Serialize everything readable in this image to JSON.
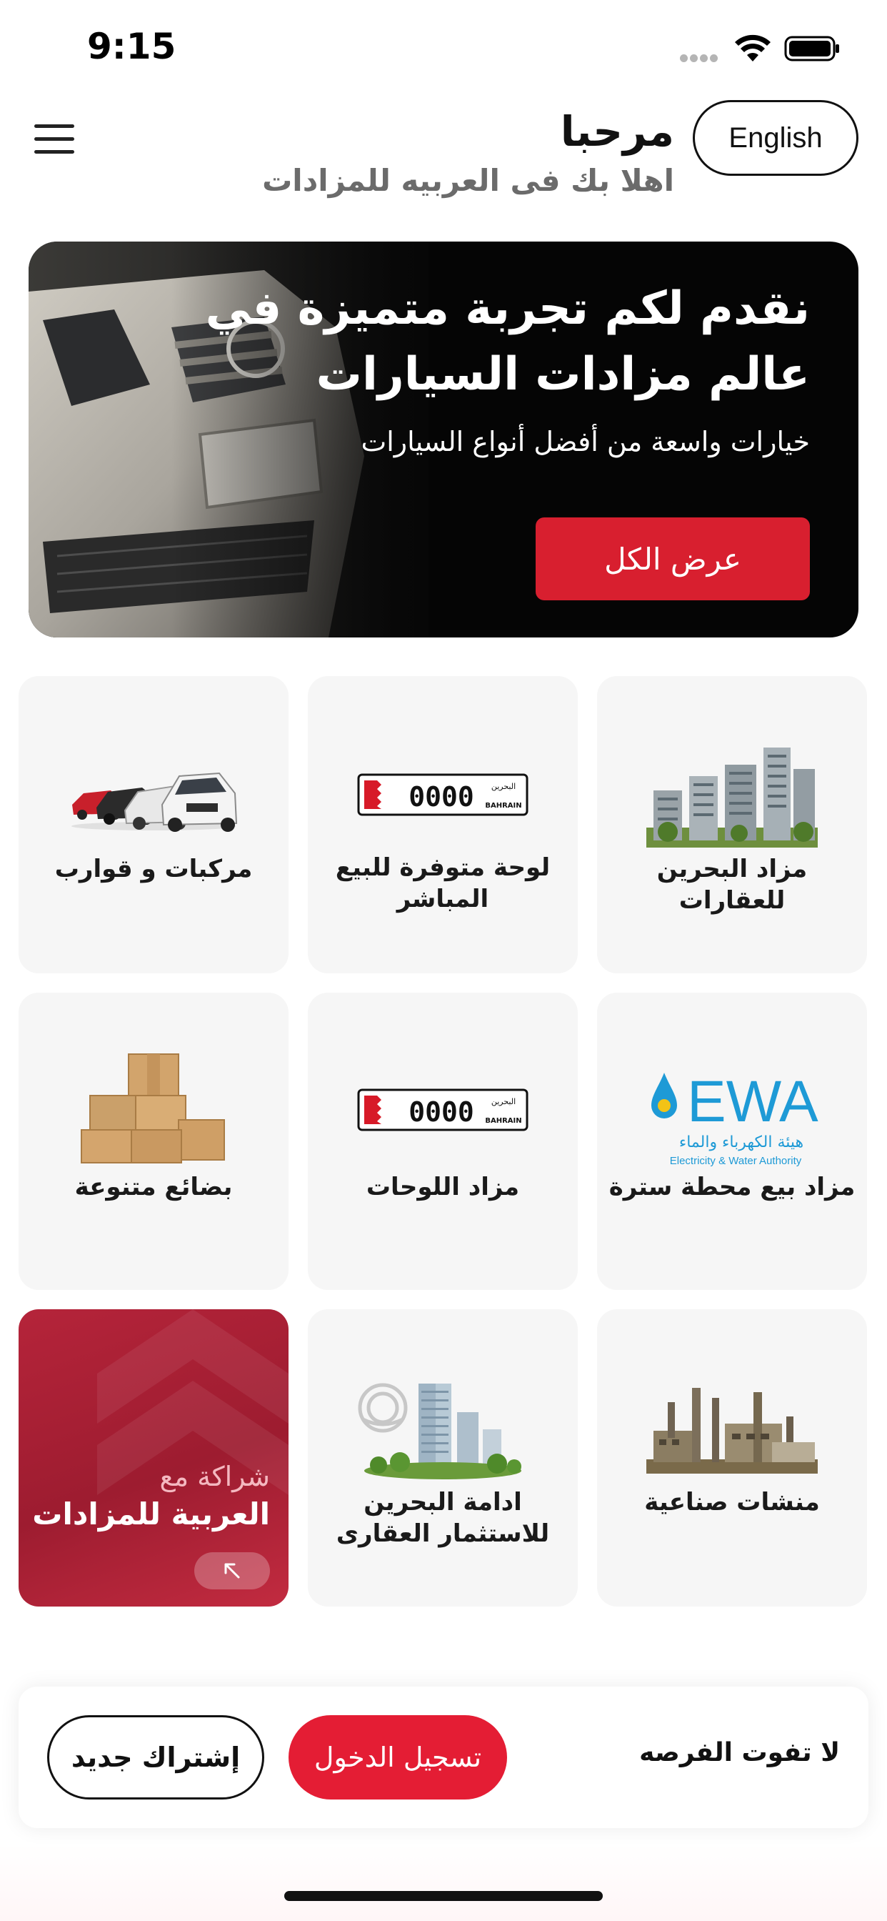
{
  "status_bar": {
    "time": "9:15"
  },
  "header": {
    "title": "مرحبا",
    "subtitle": "اهلا بك فى العربيه للمزادات",
    "language_button": "English"
  },
  "hero": {
    "title": "نقدم لكم تجربة متميزة في عالم مزادات السيارات",
    "subtitle": "خيارات واسعة من أفضل أنواع السيارات",
    "button_label": "عرض الكل"
  },
  "categories": [
    {
      "label": "مزاد البحرين للعقارات",
      "icon": "buildings-icon"
    },
    {
      "label": "لوحة متوفرة للبيع المباشر",
      "icon": "license-plate-icon"
    },
    {
      "label": "مركبات و قوارب",
      "icon": "cars-icon"
    },
    {
      "label": "مزاد بيع محطة سترة",
      "icon": "ewa-logo-icon"
    },
    {
      "label": "مزاد اللوحات",
      "icon": "license-plate-icon"
    },
    {
      "label": "بضائع متنوعة",
      "icon": "boxes-icon"
    },
    {
      "label": "منشات صناعية",
      "icon": "factory-icon"
    },
    {
      "label": "ادامة البحرين للاستثمار العقارى",
      "icon": "tower-icon"
    }
  ],
  "plate": {
    "number": "0000",
    "country_ar": "البحرين",
    "country_en": "BAHRAIN"
  },
  "ewa_logo": {
    "brand": "EWA",
    "arabic": "هيئة الكهرباء والماء",
    "english": "Electricity & Water Authority"
  },
  "partner_card": {
    "line1": "شراكة مع",
    "line2": "العربية للمزادات"
  },
  "bottom_bar": {
    "text": "لا تفوت الفرصه",
    "login_label": "تسجيل الدخول",
    "signup_label": "إشتراك جديد"
  },
  "colors": {
    "accent_red": "#e41d34",
    "partner_red": "#b5243a",
    "card_bg": "#f6f6f6"
  }
}
